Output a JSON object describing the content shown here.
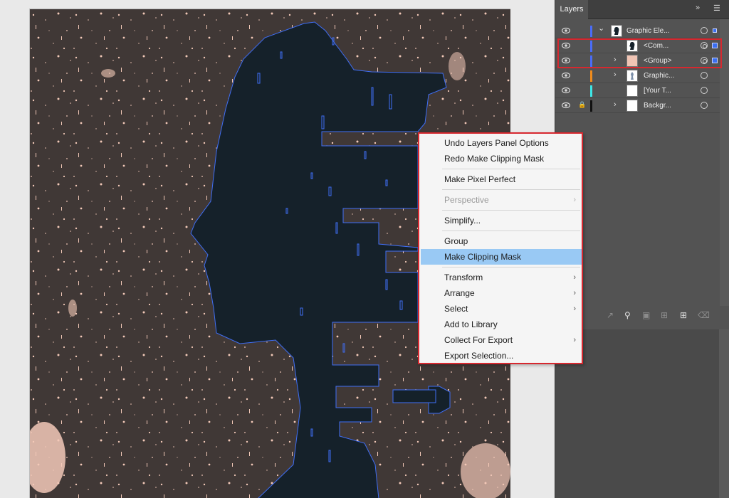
{
  "layers_panel": {
    "tab_label": "Layers",
    "collapse_icon": "double-chevron-right",
    "menu_icon": "hamburger-menu",
    "layers": [
      {
        "name": "Graphic Ele...",
        "color": "#4a6cf7",
        "expanded": true,
        "thumb": "silhouette",
        "target": "single"
      },
      {
        "name": "<Com...",
        "color": "#4a6cf7",
        "thumb": "silhouette",
        "target": "double",
        "selected": true
      },
      {
        "name": "<Group>",
        "color": "#4a6cf7",
        "thumb": "pink",
        "target": "double",
        "selected": true
      },
      {
        "name": "Graphic...",
        "color": "#f08c1c",
        "thumb": "figure",
        "target": "single"
      },
      {
        "name": "[Your T...",
        "color": "#3ee6e6",
        "thumb": "white",
        "target": "single"
      },
      {
        "name": "Backgr...",
        "color": "#111111",
        "thumb": "white",
        "locked": true,
        "target": "single"
      }
    ],
    "footer_icons": [
      "export-icon",
      "search-icon",
      "clipping-mask-icon",
      "new-sublayer-icon",
      "new-layer-icon",
      "delete-icon"
    ]
  },
  "context_menu": {
    "groups": [
      [
        {
          "label": "Undo Layers Panel Options"
        },
        {
          "label": "Redo Make Clipping Mask"
        }
      ],
      [
        {
          "label": "Make Pixel Perfect"
        }
      ],
      [
        {
          "label": "Perspective",
          "disabled": true,
          "submenu": true
        }
      ],
      [
        {
          "label": "Simplify..."
        }
      ],
      [
        {
          "label": "Group"
        },
        {
          "label": "Make Clipping Mask",
          "highlighted": true
        }
      ],
      [
        {
          "label": "Transform",
          "submenu": true
        },
        {
          "label": "Arrange",
          "submenu": true
        },
        {
          "label": "Select",
          "submenu": true
        },
        {
          "label": "Add to Library"
        },
        {
          "label": "Collect For Export",
          "submenu": true
        },
        {
          "label": "Export Selection..."
        }
      ]
    ]
  },
  "colors": {
    "artboard_bg": "#403836",
    "silhouette_fill": "#15212a",
    "selection_outline": "#3f6ef5",
    "speckle": "#f3c9b8",
    "highlight_red": "#d7282f",
    "menu_highlight": "#99c9f4"
  }
}
